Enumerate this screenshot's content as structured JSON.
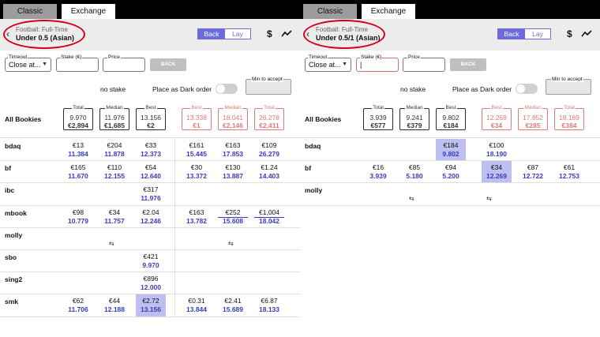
{
  "panels": [
    {
      "tabs": {
        "classic": "Classic",
        "exchange": "Exchange"
      },
      "sport": "Football: Full-Time",
      "market": "Under 0.5 (Asian)",
      "back_label": "Back",
      "lay_label": "Lay",
      "currency": "$",
      "timeout_label": "Timeout",
      "timeout_value": "Close at...",
      "stake_label": "Stake (€)",
      "stake_value": "",
      "price_label": "Price",
      "price_value": "",
      "back_button": "BACK",
      "no_stake": "no stake",
      "dark_order": "Place as Dark order",
      "min_accept": "Min to accept",
      "all_bookies": "All Bookies",
      "summary": {
        "back": [
          {
            "cap": "Total",
            "odds": "9.970",
            "stake": "€2,894"
          },
          {
            "cap": "Median",
            "odds": "11.976",
            "stake": "€1,685"
          },
          {
            "cap": "Best",
            "odds": "13.156",
            "stake": "€2"
          }
        ],
        "lay": [
          {
            "cap": "Best",
            "odds": "13.338",
            "stake": "€1"
          },
          {
            "cap": "Median",
            "odds": "18.041",
            "stake": "€2,146"
          },
          {
            "cap": "Total",
            "odds": "26.278",
            "stake": "€2,411"
          }
        ]
      },
      "bookies": [
        {
          "name": "bdaq",
          "cells": [
            {
              "s": "€13",
              "o": "11.384"
            },
            {
              "s": "€204",
              "o": "11.878"
            },
            {
              "s": "€33",
              "o": "12.373"
            },
            {
              "s": "€161",
              "o": "15.445"
            },
            {
              "s": "€163",
              "o": "17.853"
            },
            {
              "s": "€109",
              "o": "26.279"
            }
          ]
        },
        {
          "name": "bf",
          "cells": [
            {
              "s": "€165",
              "o": "11.670"
            },
            {
              "s": "€110",
              "o": "12.155"
            },
            {
              "s": "€54",
              "o": "12.640"
            },
            {
              "s": "€30",
              "o": "13.372"
            },
            {
              "s": "€130",
              "o": "13.887"
            },
            {
              "s": "€1.24",
              "o": "14.403"
            }
          ]
        },
        {
          "name": "ibc",
          "cells": [
            null,
            null,
            {
              "s": "€317",
              "o": "11.976"
            },
            null,
            null,
            null
          ]
        },
        {
          "name": "mbook",
          "cells": [
            {
              "s": "€98",
              "o": "10.779"
            },
            {
              "s": "€34",
              "o": "11.757"
            },
            {
              "s": "€2.04",
              "o": "12.246"
            },
            {
              "s": "€163",
              "o": "13.782"
            },
            {
              "s": "€252",
              "o": "15.608"
            },
            {
              "s": "€1,004",
              "o": "18.042"
            }
          ]
        },
        {
          "name": "molly",
          "cells": [],
          "swap": "⇆"
        },
        {
          "name": "sbo",
          "cells": [
            null,
            null,
            {
              "s": "€421",
              "o": "9.970"
            },
            null,
            null,
            null
          ]
        },
        {
          "name": "sing2",
          "cells": [
            null,
            null,
            {
              "s": "€896",
              "o": "12.000"
            },
            null,
            null,
            null
          ]
        },
        {
          "name": "smk",
          "cells": [
            {
              "s": "€62",
              "o": "11.706"
            },
            {
              "s": "€44",
              "o": "12.188"
            },
            {
              "s": "€2.72",
              "o": "13.156"
            },
            {
              "s": "€0.31",
              "o": "13.844"
            },
            {
              "s": "€2.41",
              "o": "15.689"
            },
            {
              "s": "€6.87",
              "o": "18.133"
            }
          ]
        }
      ]
    },
    {
      "tabs": {
        "classic": "Classic",
        "exchange": "Exchange"
      },
      "sport": "Football: Full-Time",
      "market": "Under 0.5/1 (Asian)",
      "back_label": "Back",
      "lay_label": "Lay",
      "currency": "$",
      "timeout_label": "Timeout",
      "timeout_value": "Close at...",
      "stake_label": "Stake (€)",
      "stake_value": "|",
      "price_label": "Price",
      "price_value": "",
      "back_button": "BACK",
      "no_stake": "no stake",
      "dark_order": "Place as Dark order",
      "min_accept": "Min to accept",
      "all_bookies": "All Bookies",
      "summary": {
        "back": [
          {
            "cap": "Total",
            "odds": "3.939",
            "stake": "€577"
          },
          {
            "cap": "Median",
            "odds": "9.241",
            "stake": "€379"
          },
          {
            "cap": "Best",
            "odds": "9.802",
            "stake": "€184"
          }
        ],
        "lay": [
          {
            "cap": "Best",
            "odds": "12.268",
            "stake": "€34"
          },
          {
            "cap": "Median",
            "odds": "17.852",
            "stake": "€285"
          },
          {
            "cap": "Total",
            "odds": "18.189",
            "stake": "€384"
          }
        ]
      },
      "bookies": [
        {
          "name": "bdaq",
          "cells": [
            null,
            null,
            {
              "s": "€184",
              "o": "9.802"
            },
            {
              "s": "€100",
              "o": "18.190"
            },
            null,
            null
          ]
        },
        {
          "name": "bf",
          "cells": [
            {
              "s": "€16",
              "o": "3.939"
            },
            {
              "s": "€85",
              "o": "5.180"
            },
            {
              "s": "€94",
              "o": "5.200"
            },
            {
              "s": "€34",
              "o": "12.269"
            },
            {
              "s": "€87",
              "o": "12.722"
            },
            {
              "s": "€61",
              "o": "12.753"
            }
          ]
        },
        {
          "name": "molly",
          "cells": [],
          "swap": "⇆"
        }
      ]
    }
  ]
}
